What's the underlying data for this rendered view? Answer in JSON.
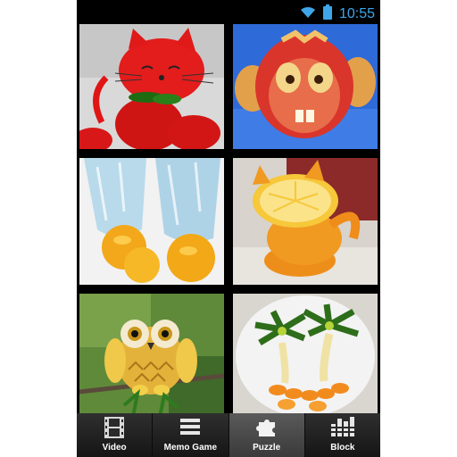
{
  "status_bar": {
    "time": "10:55",
    "wifi_icon": "wifi-icon",
    "battery_icon": "battery-icon",
    "accent_color": "#3ea6e8"
  },
  "gallery": {
    "tiles": [
      {
        "subject": "strawberry-cat"
      },
      {
        "subject": "apple-monkey"
      },
      {
        "subject": "oranges-splashing-in-water"
      },
      {
        "subject": "orange-cat"
      },
      {
        "subject": "pineapple-owl"
      },
      {
        "subject": "fruit-palm-trees-plate"
      }
    ]
  },
  "tabbar": {
    "tabs": [
      {
        "label": "Video",
        "icon": "film-icon",
        "selected": false
      },
      {
        "label": "Memo Game",
        "icon": "menu-icon",
        "selected": false
      },
      {
        "label": "Puzzle",
        "icon": "puzzle-icon",
        "selected": true
      },
      {
        "label": "Block",
        "icon": "blocks-icon",
        "selected": false
      }
    ]
  }
}
